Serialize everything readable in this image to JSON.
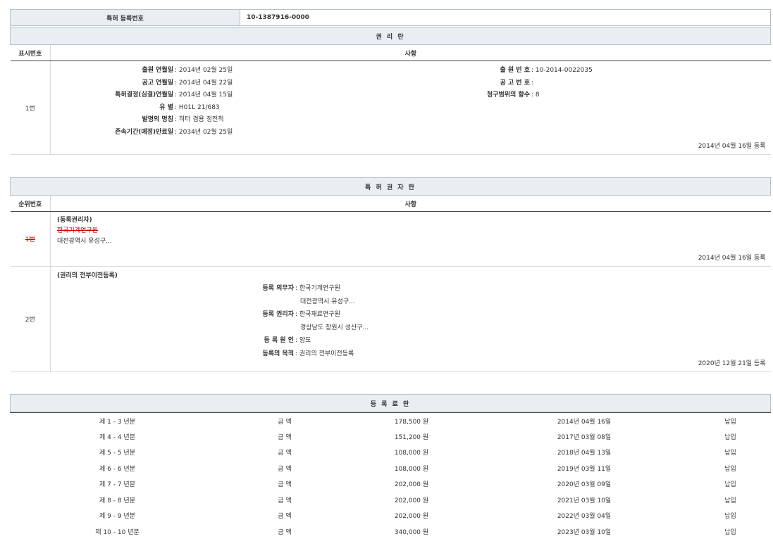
{
  "top": {
    "label": "특허 등록번호",
    "value": "10-1387916-0000",
    "section_title": "권 리 란"
  },
  "rights": {
    "col1": "표시번호",
    "col2": "사항",
    "row": {
      "num": "1번",
      "left": [
        {
          "k": "출원 연월일",
          "v": ": 2014년 02월 25일"
        },
        {
          "k": "공고 연월일",
          "v": ": 2014년 04월 22일"
        },
        {
          "k": "특허결정(심결)연월일",
          "v": ": 2014년 04월 15일"
        },
        {
          "k": "유 별",
          "v": ": H01L 21/683"
        },
        {
          "k": "발명의 명칭",
          "v": ": 히터 겸용 정전척"
        },
        {
          "k": "존속기간(예정)만료일",
          "v": ": 2034년 02월 25일"
        }
      ],
      "right": [
        {
          "k": "출 원 번 호",
          "v": ": 10-2014-0022035"
        },
        {
          "k": "공 고 번 호",
          "v": ":"
        },
        {
          "k": "청구범위의 항수",
          "v": ": 8"
        }
      ],
      "reg_date": "2014년 04월 16일 등록"
    }
  },
  "holders": {
    "title": "특 허 권 자 란",
    "col1": "순위번호",
    "col2": "사항",
    "rows": [
      {
        "num": "1번",
        "type": "(등록권리자)",
        "name": "한국기계연구원",
        "addr": "대전광역시 유성구...",
        "reg_date": "2014년 04월 16일 등록"
      },
      {
        "num": "2번",
        "type": "(권리의 전부이전등록)",
        "items": [
          {
            "k": "등록 의무자",
            "v": ": 한국기계연구원"
          },
          {
            "k": "",
            "v": "대전광역시 유성구..."
          },
          {
            "k": "등록 권리자",
            "v": ": 한국재료연구원"
          },
          {
            "k": "",
            "v": "경상남도 창원시 성산구..."
          },
          {
            "k": "등 록 원 인",
            "v": ": 양도"
          },
          {
            "k": "등록의 목적",
            "v": ": 권리의 전부이전등록"
          }
        ],
        "reg_date": "2020년 12월 21일 등록"
      }
    ]
  },
  "fees": {
    "title": "등 록 료 란",
    "rows": [
      {
        "year": "제 1 - 3 년분",
        "label": "금 액",
        "amount": "178,500 원",
        "date": "2014년 04월 16일",
        "status": "납입"
      },
      {
        "year": "제 4 - 4 년분",
        "label": "금 액",
        "amount": "151,200 원",
        "date": "2017년 03월 08일",
        "status": "납입"
      },
      {
        "year": "제 5 - 5 년분",
        "label": "금 액",
        "amount": "108,000 원",
        "date": "2018년 04월 13일",
        "status": "납입"
      },
      {
        "year": "제 6 - 6 년분",
        "label": "금 액",
        "amount": "108,000 원",
        "date": "2019년 03월 11일",
        "status": "납입"
      },
      {
        "year": "제 7 - 7 년분",
        "label": "금 액",
        "amount": "202,000 원",
        "date": "2020년 03월 09일",
        "status": "납입"
      },
      {
        "year": "제 8 - 8 년분",
        "label": "금 액",
        "amount": "202,000 원",
        "date": "2021년 03월 10일",
        "status": "납입"
      },
      {
        "year": "제 9 - 9 년분",
        "label": "금 액",
        "amount": "202,000 원",
        "date": "2022년 03월 04일",
        "status": "납입"
      },
      {
        "year": "제 10 - 10 년분",
        "label": "금 액",
        "amount": "340,000 원",
        "date": "2023년 03월 10일",
        "status": "납입"
      }
    ]
  }
}
